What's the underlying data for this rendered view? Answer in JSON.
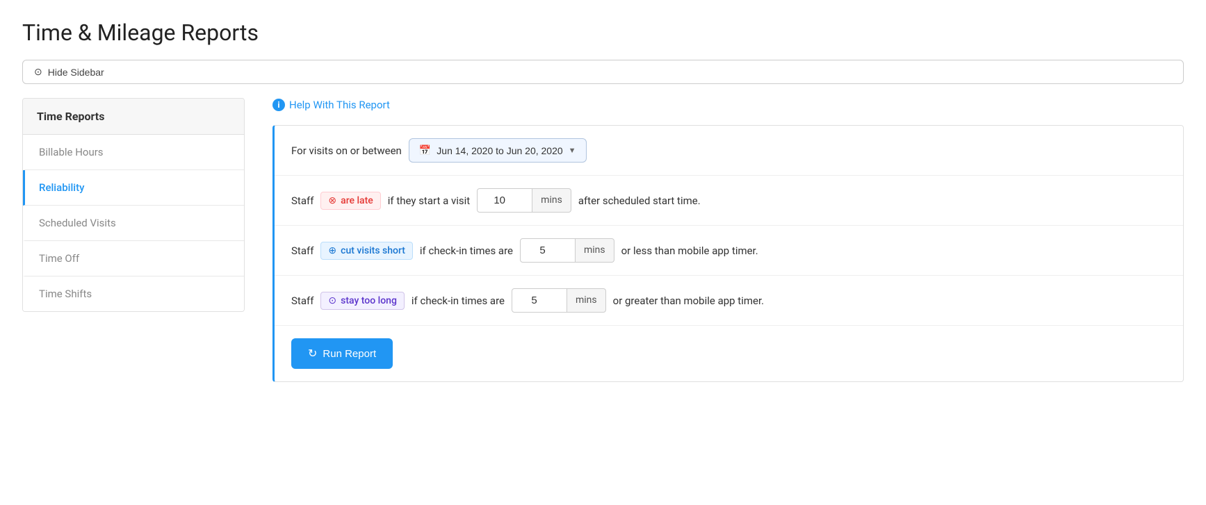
{
  "page": {
    "title": "Time & Mileage Reports"
  },
  "toolbar": {
    "hide_sidebar_label": "Hide Sidebar",
    "eye_icon": "👁"
  },
  "sidebar": {
    "header": "Time Reports",
    "items": [
      {
        "id": "billable-hours",
        "label": "Billable Hours",
        "active": false
      },
      {
        "id": "reliability",
        "label": "Reliability",
        "active": true
      },
      {
        "id": "scheduled-visits",
        "label": "Scheduled Visits",
        "active": false
      },
      {
        "id": "time-off",
        "label": "Time Off",
        "active": false
      },
      {
        "id": "time-shifts",
        "label": "Time Shifts",
        "active": false
      }
    ]
  },
  "content": {
    "help_link": "Help With This Report",
    "date_range": "Jun 14, 2020 to Jun 20, 2020",
    "date_prefix": "For visits on or between",
    "row1": {
      "prefix": "Staff",
      "badge": "are late",
      "middle": "if they start a visit",
      "value": "10",
      "unit": "mins",
      "suffix": "after scheduled start time."
    },
    "row2": {
      "prefix": "Staff",
      "badge": "cut visits short",
      "middle": "if check-in times are",
      "value": "5",
      "unit": "mins",
      "suffix": "or less than mobile app timer."
    },
    "row3": {
      "prefix": "Staff",
      "badge": "stay too long",
      "middle": "if check-in times are",
      "value": "5",
      "unit": "mins",
      "suffix": "or greater than mobile app timer."
    },
    "run_button": "Run Report"
  }
}
